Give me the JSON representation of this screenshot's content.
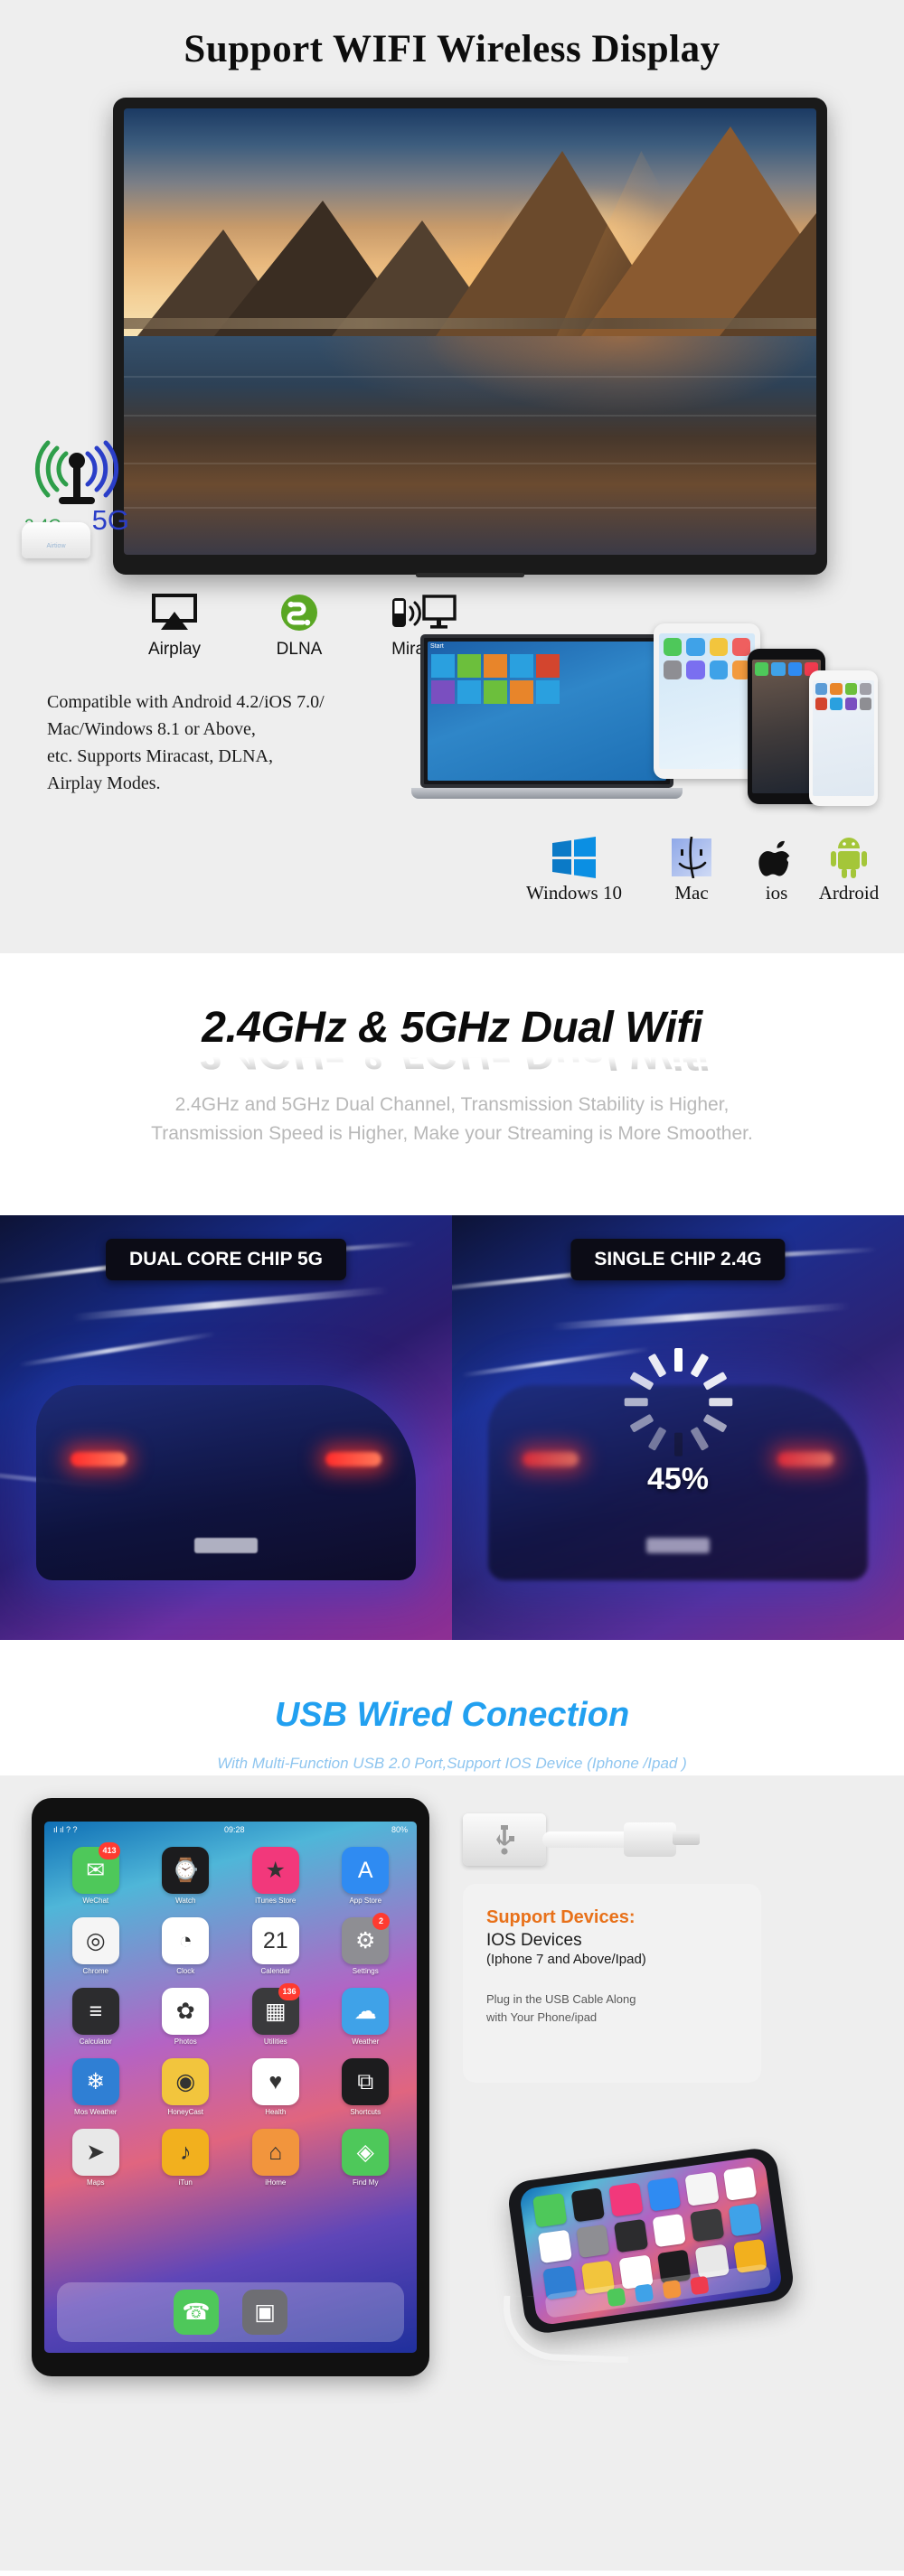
{
  "section1": {
    "title": "Support WIFI Wireless Display",
    "wifi_icon": {
      "band_24_label": "2.4G",
      "band_5_label": "5G",
      "band_24_color": "#2e9e4a",
      "band_5_color": "#2a3ec8",
      "router_label": "Airtiow"
    },
    "cast_modes": [
      {
        "icon": "airplay-icon",
        "label": "Airplay"
      },
      {
        "icon": "dlna-icon",
        "label": "DLNA"
      },
      {
        "icon": "miracast-icon",
        "label": "Miracast"
      }
    ],
    "compat_lines": [
      "Compatible with Android 4.2/iOS 7.0/",
      "Mac/Windows 8.1 or Above,",
      " etc. Supports Miracast, DLNA,",
      "Airplay Modes."
    ],
    "os_support": [
      {
        "icon": "windows-logo-icon",
        "label": "Windows 10"
      },
      {
        "icon": "mac-finder-icon",
        "label": "Mac"
      },
      {
        "icon": "apple-logo-icon",
        "label": "ios"
      },
      {
        "icon": "android-robot-icon",
        "label": "Ardroid"
      }
    ],
    "laptop_start_label": "Start"
  },
  "section2": {
    "heading": "2.4GHz & 5GHz Dual Wifi",
    "sub_line1": "2.4GHz and 5GHz Dual Channel, Transmission Stability is Higher,",
    "sub_line2": "Transmission Speed is Higher, Make your Streaming is More Smoother.",
    "panel_left_badge": "DUAL CORE CHIP 5G",
    "panel_right_badge": "SINGLE CHIP 2.4G",
    "buffering_percent": "45%"
  },
  "section3": {
    "heading": "USB Wired Conection",
    "heading_color": "#22a0f0",
    "sub": "With Multi-Function USB 2.0 Port,Support IOS Device (Iphone /Ipad )",
    "sub_color": "#8ec5ef",
    "info_card": {
      "title": "Support Devices:",
      "title_color": "#e8711a",
      "line1": "IOS Devices",
      "line2": "(Iphone 7 and Above/Ipad)",
      "para_line1": "Plug in the USB Cable Along",
      "para_line2": "with Your Phone/ipad"
    },
    "tablet": {
      "status_left": "ıl ıl ? ?",
      "status_mid": "09:28",
      "status_right": "80%",
      "apps": [
        {
          "name": "WeChat",
          "glyph": "✉",
          "color": "#4ec85a",
          "badge": "413"
        },
        {
          "name": "Watch",
          "glyph": "⌚",
          "color": "#1c1c1e",
          "badge": ""
        },
        {
          "name": "iTunes Store",
          "glyph": "★",
          "color": "#f2387b",
          "badge": ""
        },
        {
          "name": "App Store",
          "glyph": "A",
          "color": "#2f8bf2",
          "badge": ""
        },
        {
          "name": "Chrome",
          "glyph": "◎",
          "color": "#f5f5f5",
          "badge": ""
        },
        {
          "name": "Clock",
          "glyph": "◔",
          "color": "#ffffff",
          "badge": ""
        },
        {
          "name": "Calendar",
          "glyph": "21",
          "color": "#ffffff",
          "badge": ""
        },
        {
          "name": "Settings",
          "glyph": "⚙",
          "color": "#8e8e93",
          "badge": "2"
        },
        {
          "name": "Calculator",
          "glyph": "≡",
          "color": "#2c2c2e",
          "badge": ""
        },
        {
          "name": "Photos",
          "glyph": "✿",
          "color": "#ffffff",
          "badge": ""
        },
        {
          "name": "Utilities",
          "glyph": "▦",
          "color": "#3a3a3c",
          "badge": "136"
        },
        {
          "name": "Weather",
          "glyph": "☁",
          "color": "#3fa2e8",
          "badge": ""
        },
        {
          "name": "Mos Weather",
          "glyph": "❄",
          "color": "#2f7fd4",
          "badge": ""
        },
        {
          "name": "HoneyCast",
          "glyph": "◉",
          "color": "#f2c53d",
          "badge": ""
        },
        {
          "name": "Health",
          "glyph": "♥",
          "color": "#ffffff",
          "badge": ""
        },
        {
          "name": "Shortcuts",
          "glyph": "⧉",
          "color": "#1c1c1e",
          "badge": ""
        },
        {
          "name": "Maps",
          "glyph": "➤",
          "color": "#e8e8e8",
          "badge": ""
        },
        {
          "name": "iTun",
          "glyph": "♪",
          "color": "#f2b01e",
          "badge": ""
        },
        {
          "name": "iHome",
          "glyph": "⌂",
          "color": "#f2953d",
          "badge": ""
        },
        {
          "name": "Find My",
          "glyph": "◈",
          "color": "#4ec85a",
          "badge": ""
        }
      ],
      "dock": [
        {
          "name": "Phone",
          "glyph": "☎",
          "color": "#4ec85a"
        },
        {
          "name": "Camera",
          "glyph": "▣",
          "color": "#6e6e73"
        }
      ]
    }
  }
}
